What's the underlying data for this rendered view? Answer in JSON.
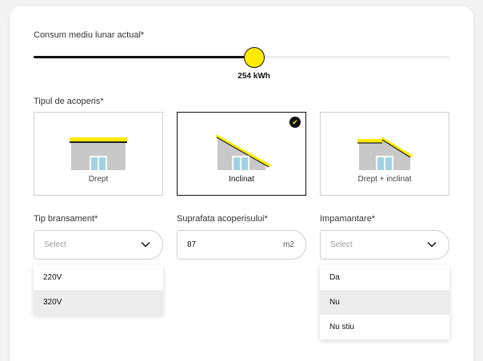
{
  "consumption": {
    "label": "Consum mediu lunar actual*",
    "value_label": "254 kWh",
    "fraction": 0.53
  },
  "roof": {
    "label": "Tipul de acoperis*",
    "options": [
      {
        "label": "Drept"
      },
      {
        "label": "Inclinat"
      },
      {
        "label": "Drept + inclinat"
      }
    ],
    "selected_index": 1
  },
  "connection": {
    "label": "Tip bransament*",
    "placeholder": "Select",
    "options": [
      "220V",
      "320V"
    ],
    "highlighted_index": 1
  },
  "area": {
    "label": "Suprafata acoperisului*",
    "value": "87",
    "unit": "m2"
  },
  "grounding": {
    "label": "Impamantare*",
    "placeholder": "Select",
    "options": [
      "Da",
      "Nu",
      "Nu stiu"
    ],
    "highlighted_index": 1
  },
  "colors": {
    "accent": "#ffea00",
    "dark": "#111111",
    "wall": "#c8c8c8",
    "window": "#9fd3e3"
  }
}
